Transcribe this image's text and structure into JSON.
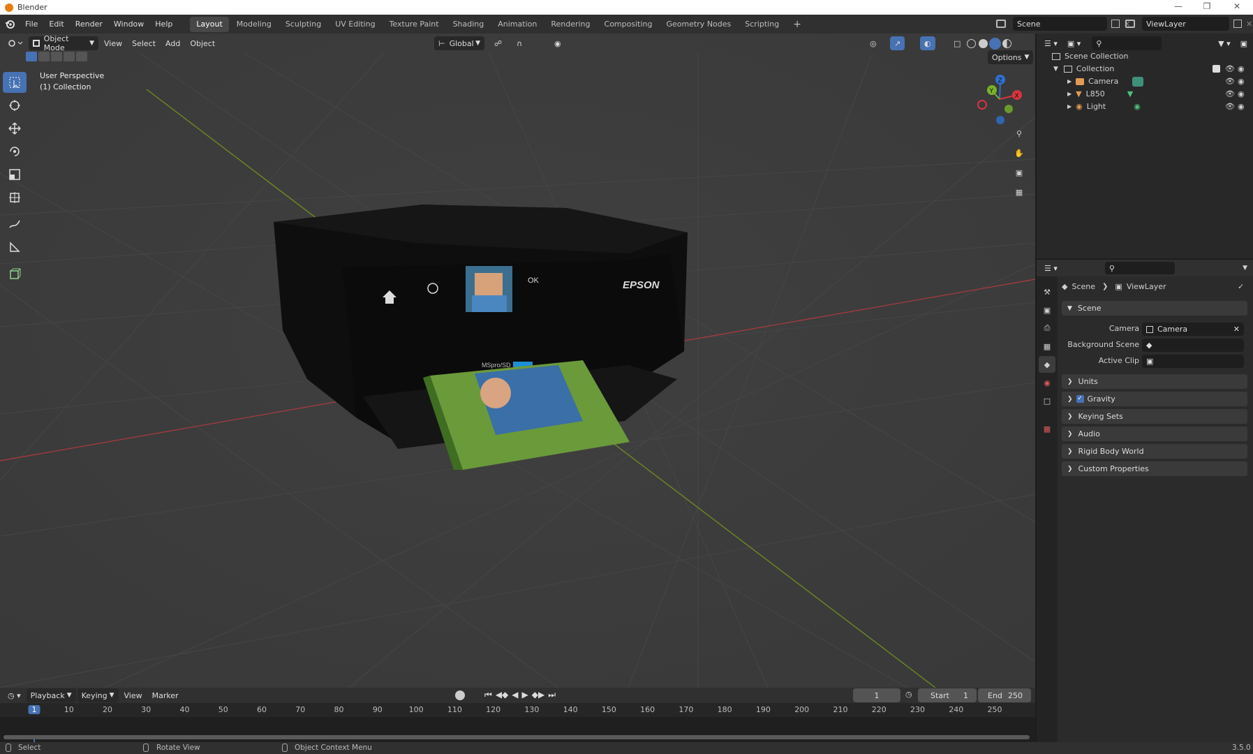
{
  "window": {
    "title": "Blender"
  },
  "menu": [
    "File",
    "Edit",
    "Render",
    "Window",
    "Help"
  ],
  "workspaces": [
    "Layout",
    "Modeling",
    "Sculpting",
    "UV Editing",
    "Texture Paint",
    "Shading",
    "Animation",
    "Rendering",
    "Compositing",
    "Geometry Nodes",
    "Scripting"
  ],
  "scene_field": "Scene",
  "viewlayer_field": "ViewLayer",
  "viewport": {
    "mode": "Object Mode",
    "menus": [
      "View",
      "Select",
      "Add",
      "Object"
    ],
    "orientation": "Global",
    "options_label": "Options",
    "overlay_title": "User Perspective",
    "overlay_sub": "(1) Collection",
    "gizmo": {
      "z": "Z",
      "y": "Y",
      "x": "X"
    }
  },
  "printer": {
    "brand": "EPSON",
    "card_label": "MSpro/SD",
    "ok_label": "OK"
  },
  "outliner": {
    "scene_collection": "Scene Collection",
    "collection": "Collection",
    "objects": [
      "Camera",
      "L850",
      "Light"
    ]
  },
  "properties": {
    "breadcrumb_scene": "Scene",
    "breadcrumb_layer": "ViewLayer",
    "section_scene": "Scene",
    "camera_label": "Camera",
    "camera_value": "Camera",
    "background_scene_label": "Background Scene",
    "active_clip_label": "Active Clip",
    "sections": [
      "Units",
      "Gravity",
      "Keying Sets",
      "Audio",
      "Rigid Body World",
      "Custom Properties"
    ]
  },
  "timeline": {
    "menus": [
      "Playback",
      "Keying",
      "View",
      "Marker"
    ],
    "current_frame": "1",
    "start_label": "Start",
    "start_value": "1",
    "end_label": "End",
    "end_value": "250",
    "ticks": [
      "1",
      "10",
      "20",
      "30",
      "40",
      "50",
      "60",
      "70",
      "80",
      "90",
      "100",
      "110",
      "120",
      "130",
      "140",
      "150",
      "160",
      "170",
      "180",
      "190",
      "200",
      "210",
      "220",
      "230",
      "240",
      "250"
    ]
  },
  "status": {
    "left": "Select",
    "middle": "Rotate View",
    "right": "Object Context Menu",
    "version": "3.5.0"
  }
}
